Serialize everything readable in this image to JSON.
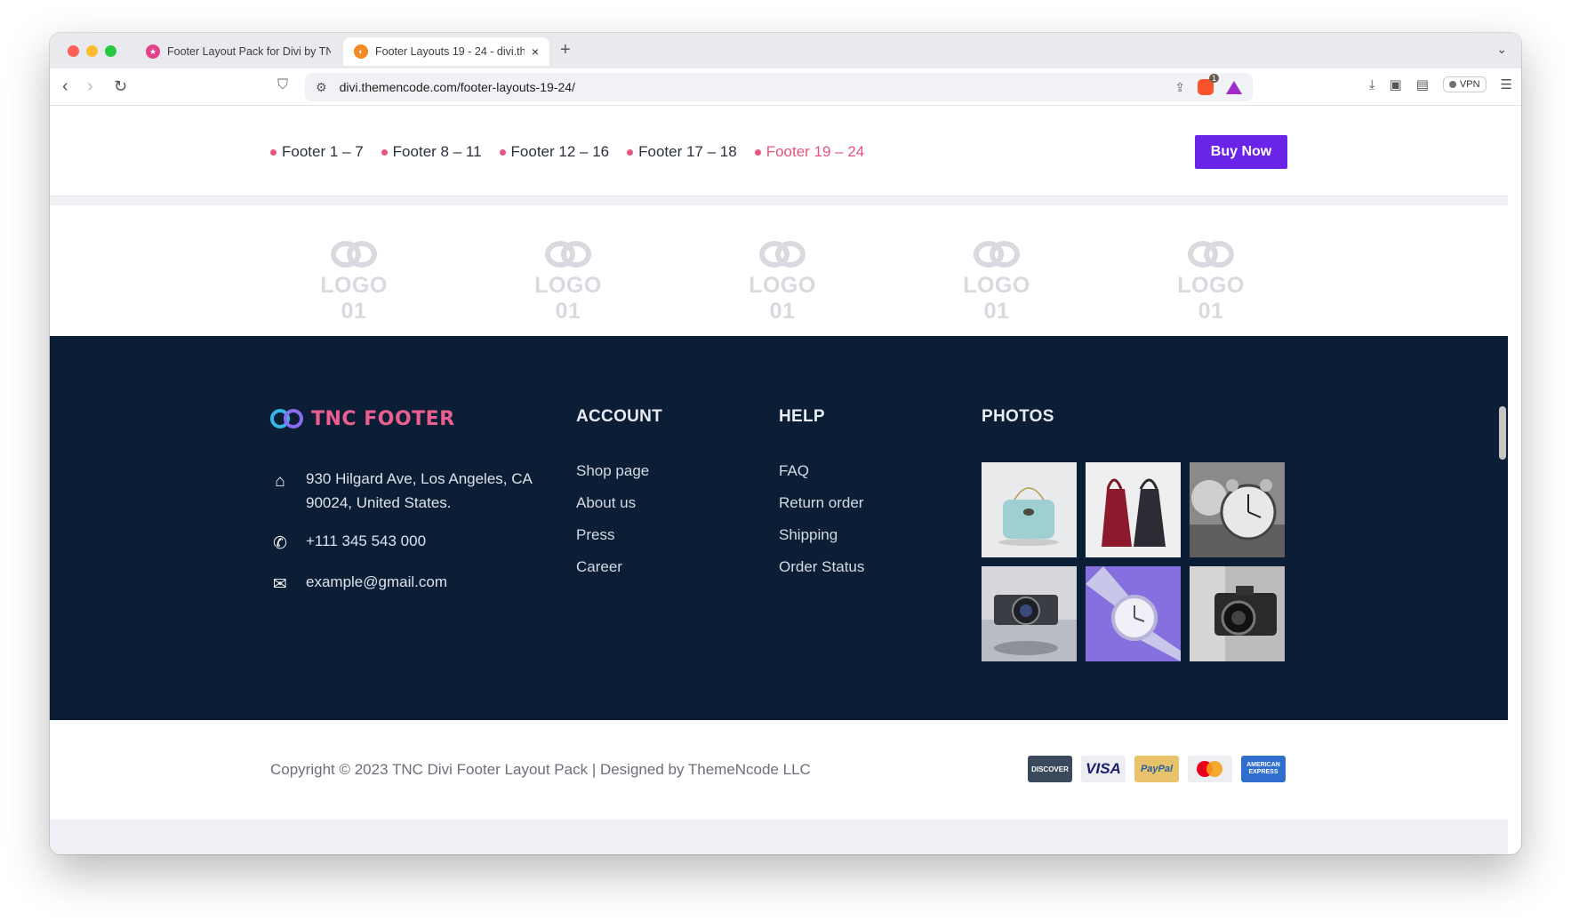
{
  "browser": {
    "tabs": [
      {
        "title": "Footer Layout Pack for Divi by TNC",
        "active": false
      },
      {
        "title": "Footer Layouts 19 - 24 - divi.themencode",
        "active": true
      }
    ],
    "new_tab": "+",
    "close": "×",
    "url": "divi.themencode.com/footer-layouts-19-24/",
    "shield_count": "1",
    "vpn_label": "VPN"
  },
  "nav": {
    "links": [
      {
        "label": "Footer 1 – 7",
        "active": false
      },
      {
        "label": "Footer 8 – 11",
        "active": false
      },
      {
        "label": "Footer 12 – 16",
        "active": false
      },
      {
        "label": "Footer 17 – 18",
        "active": false
      },
      {
        "label": "Footer 19 – 24",
        "active": true
      }
    ],
    "buy_label": "Buy Now"
  },
  "logos": [
    "LOGO 01",
    "LOGO 01",
    "LOGO 01",
    "LOGO 01",
    "LOGO 01"
  ],
  "footer": {
    "brand": "TNC FOOTER",
    "address": "930 Hilgard Ave, Los Angeles, CA 90024, United States.",
    "phone": "+111 345 543 000",
    "email": "example@gmail.com",
    "account": {
      "heading": "ACCOUNT",
      "links": [
        "Shop page",
        "About us",
        "Press",
        "Career"
      ]
    },
    "help": {
      "heading": "HELP",
      "links": [
        "FAQ",
        "Return order",
        "Shipping",
        "Order Status"
      ]
    },
    "photos": {
      "heading": "PHOTOS",
      "items": [
        "bag-photo",
        "red-bags-photo",
        "alarm-clocks-photo",
        "camera-photo",
        "watch-photo",
        "retro-camera-photo"
      ]
    }
  },
  "bottom": {
    "copyright": "Copyright © 2023 TNC Divi Footer Layout Pack | Designed by ThemeNcode LLC",
    "cards": {
      "discover": "DISCOVER",
      "visa": "VISA",
      "paypal": "PayPal",
      "amex": "AMERICAN EXPRESS"
    }
  },
  "colors": {
    "accent_pink": "#e5557e",
    "buy_button": "#6a24e8",
    "footer_bg": "#0c1e36"
  }
}
